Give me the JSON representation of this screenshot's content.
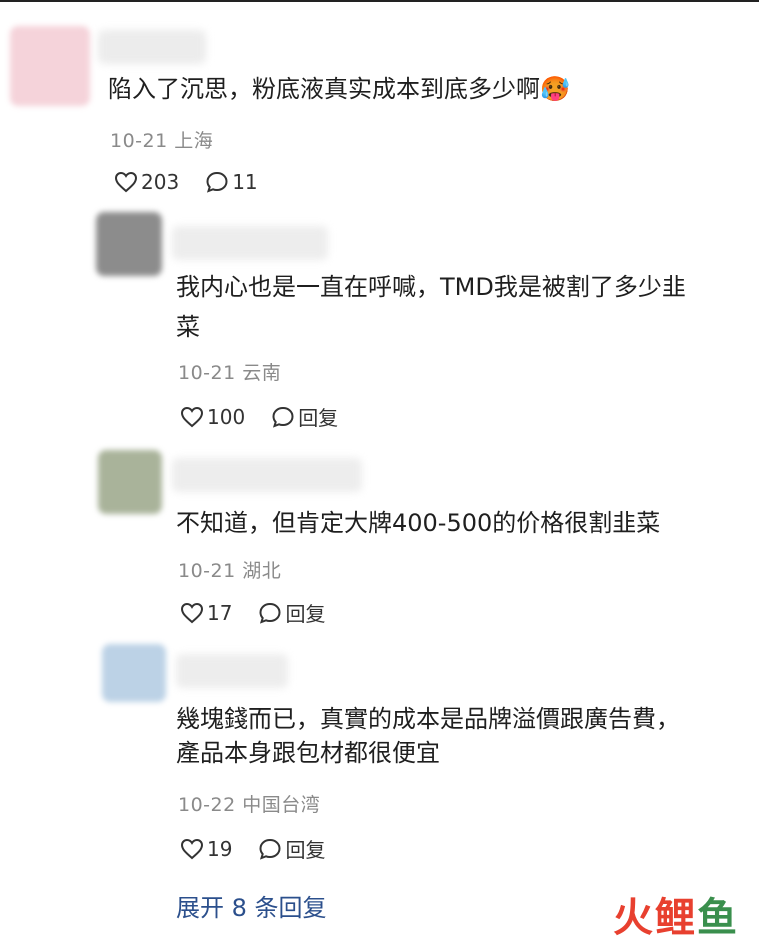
{
  "comments": [
    {
      "text": "陷入了沉思，粉底液真实成本到底多少啊",
      "emoji": "🥵",
      "meta": "10-21 上海",
      "likes": "203",
      "replies": "11",
      "avatar_color": "#f4c9d2"
    },
    {
      "text_line1": "我内心也是一直在呼喊，TMD我是被割了多少韭",
      "text_line2": "菜",
      "meta": "10-21 云南",
      "likes": "100",
      "reply_label": "回复",
      "avatar_color": "#8c8c8c"
    },
    {
      "text": "不知道，但肯定大牌400-500的价格很割韭菜",
      "meta": "10-21 湖北",
      "likes": "17",
      "reply_label": "回复",
      "avatar_color": "#a9b39a"
    },
    {
      "text_line1": "幾塊錢而已，真實的成本是品牌溢價跟廣告費，",
      "text_line2": "產品本身跟包材都很便宜",
      "meta": "10-22 中国台湾",
      "likes": "19",
      "reply_label": "回复",
      "avatar_color": "#bcd2e6"
    }
  ],
  "expand_label": "展开 8 条回复",
  "watermark": {
    "fire": "火",
    "text": "鲤",
    "fish": "鱼"
  }
}
